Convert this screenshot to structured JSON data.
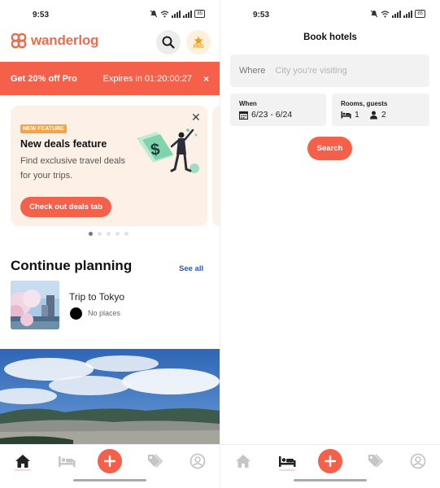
{
  "left_screen": {
    "status": {
      "time": "9:53",
      "battery": "85"
    },
    "app": {
      "logo_text": "wanderlog"
    },
    "header": {
      "pro_label": "PRO"
    },
    "promo": {
      "title": "Get 20% off Pro",
      "expires": "Expires in 01:20:00:27",
      "close_glyph": "×"
    },
    "feature_card": {
      "badge": "NEW FEATURE",
      "title": "New deals feature",
      "description": "Find exclusive travel deals for your trips.",
      "button": "Check out deals tab",
      "close_glyph": "✕"
    },
    "carousel": {
      "page_count": 5,
      "active_index": 0
    },
    "continue_planning": {
      "title": "Continue planning",
      "see_all": "See all",
      "trips": [
        {
          "name": "Trip to Tokyo",
          "places": "No places"
        }
      ]
    },
    "bottom_nav": {
      "items": [
        "home-icon",
        "hotel-icon",
        "add-icon",
        "deals-icon",
        "profile-icon"
      ],
      "active": "home-icon"
    }
  },
  "right_screen": {
    "status": {
      "time": "9:53",
      "battery": "85"
    },
    "title": "Book hotels",
    "where": {
      "label": "Where",
      "placeholder": "City you're visiting",
      "value": ""
    },
    "when": {
      "label": "When",
      "value": "6/23 - 6/24"
    },
    "rooms": {
      "label": "Rooms, guests",
      "rooms": "1",
      "guests": "2"
    },
    "search_button": "Search",
    "bottom_nav": {
      "items": [
        "home-icon",
        "hotel-icon",
        "add-icon",
        "deals-icon",
        "profile-icon"
      ],
      "active": "hotel-icon"
    }
  },
  "colors": {
    "brand": "#f4604a",
    "logo": "#ee6c4d",
    "badge": "#f5a34a",
    "link": "#2b56b3",
    "card_bg": "#fdf1e7",
    "pro_star": "#f0a020"
  }
}
